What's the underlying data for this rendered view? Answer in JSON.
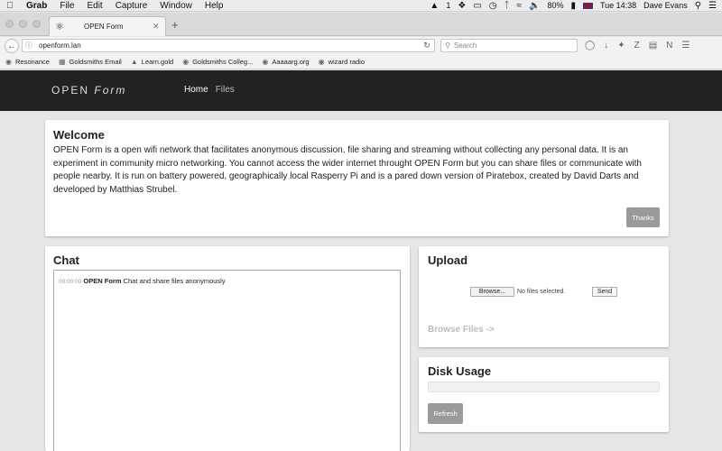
{
  "menubar": {
    "app": "Grab",
    "items": [
      "File",
      "Edit",
      "Capture",
      "Window",
      "Help"
    ],
    "battery": "80%",
    "clock": "Tue 14:38",
    "user": "Dave Evans",
    "notif_count": "1"
  },
  "browser": {
    "tab_title": "OPEN Form",
    "url": "openform.lan",
    "search_placeholder": "Search",
    "bookmarks": [
      "Resonance",
      "Goldsmiths Email",
      "Learn.gold",
      "Goldsmiths Colleg...",
      "Aaaaarg.org",
      "wizard radio"
    ]
  },
  "site": {
    "brand_a": "OPEN",
    "brand_b": "Form",
    "nav_home": "Home",
    "nav_files": "Files"
  },
  "welcome": {
    "title": "Welcome",
    "body": "OPEN Form is a open wifi network that facilitates anonymous discussion, file sharing and streaming without collecting any personal data. It is an experiment in community micro networking. You cannot access the wider internet throught OPEN Form but you can share files or communicate with people nearby. It is run on battery powered, geographically local Rasperry Pi and is a pared down version of Piratebox, created by David Darts and developed by Matthias Strubel.",
    "button": "Thanks"
  },
  "chat": {
    "title": "Chat",
    "messages": [
      {
        "time": "00:00:00",
        "nick": "OPEN Form",
        "text": "Chat and share files anonymously"
      }
    ]
  },
  "upload": {
    "title": "Upload",
    "browse_button": "Browse...",
    "no_files": "No files selected.",
    "send_button": "Send",
    "browse_files_link": "Browse Files ->"
  },
  "disk": {
    "title": "Disk Usage",
    "usage_fraction": 0,
    "refresh_button": "Refresh"
  }
}
